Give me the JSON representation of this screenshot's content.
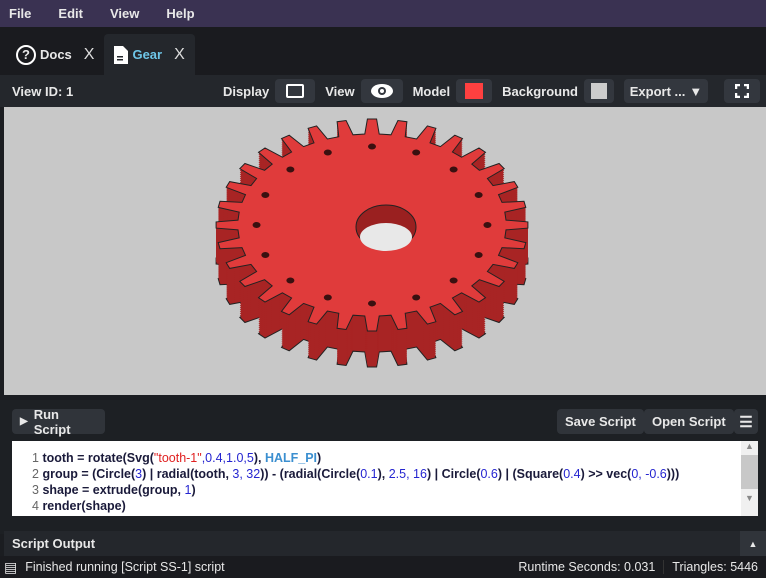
{
  "menu": [
    "File",
    "Edit",
    "View",
    "Help"
  ],
  "tabs": [
    {
      "label": "Docs",
      "close": "X"
    },
    {
      "label": "Gear",
      "close": "X"
    }
  ],
  "toolbar": {
    "view_id": "View ID: 1",
    "display": "Display",
    "view": "View",
    "model": "Model",
    "background": "Background",
    "export": "Export ...",
    "model_color": "#ff4040",
    "background_color": "#cccccc"
  },
  "script": {
    "run": "Run Script",
    "save": "Save Script",
    "open": "Open Script"
  },
  "code": [
    {
      "n": "1",
      "parts": [
        [
          "t",
          "tooth = rotate(Svg("
        ],
        [
          "s",
          "\"tooth-1\""
        ],
        [
          "n",
          ",0.4,1.0,5"
        ],
        [
          "t",
          "), "
        ],
        [
          "c",
          "HALF_PI"
        ],
        [
          "t",
          ")"
        ]
      ]
    },
    {
      "n": "2",
      "parts": [
        [
          "t",
          "group = (Circle("
        ],
        [
          "n",
          "3"
        ],
        [
          "t",
          ") | radial(tooth, "
        ],
        [
          "n",
          "3, 32"
        ],
        [
          "t",
          ")) - (radial(Circle("
        ],
        [
          "n",
          "0.1"
        ],
        [
          "t",
          "), "
        ],
        [
          "n",
          "2.5, 16"
        ],
        [
          "t",
          ") | Circle("
        ],
        [
          "n",
          "0.6"
        ],
        [
          "t",
          ") | (Square("
        ],
        [
          "n",
          "0.4"
        ],
        [
          "t",
          ") >> vec("
        ],
        [
          "n",
          "0, -0.6"
        ],
        [
          "t",
          ")))"
        ]
      ]
    },
    {
      "n": "3",
      "parts": [
        [
          "t",
          "shape = extrude(group, "
        ],
        [
          "n",
          "1"
        ],
        [
          "t",
          ")"
        ]
      ]
    },
    {
      "n": "4",
      "parts": [
        [
          "t",
          "render(shape)"
        ]
      ]
    }
  ],
  "output": {
    "title": "Script Output"
  },
  "status": {
    "message": "Finished running [Script SS-1] script",
    "runtime": "Runtime Seconds: 0.031",
    "triangles": "Triangles: 5446"
  },
  "gear": {
    "teeth": 32,
    "holes": 16,
    "color": "#e03b3b",
    "side_color": "#a82424"
  }
}
